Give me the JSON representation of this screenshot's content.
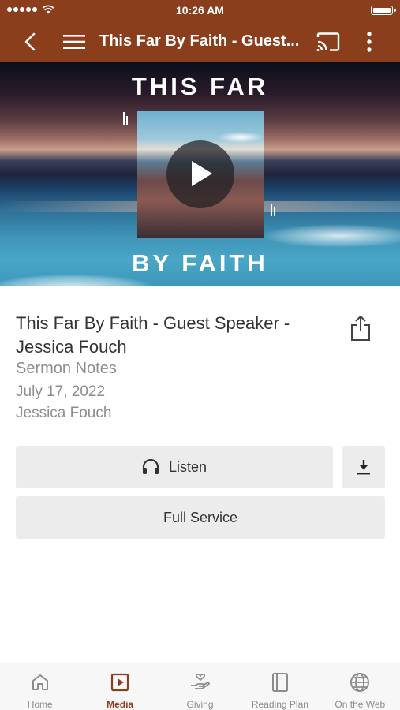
{
  "status_bar": {
    "time": "10:26 AM"
  },
  "nav": {
    "title": "This Far By Faith - Guest..."
  },
  "hero": {
    "title_top": "THIS FAR",
    "title_bottom": "BY FAITH"
  },
  "sermon": {
    "title": "This Far By Faith - Guest Speaker - Jessica Fouch",
    "series": "Sermon Notes",
    "date": "July 17, 2022",
    "speaker": "Jessica Fouch"
  },
  "actions": {
    "listen_label": "Listen",
    "full_service_label": "Full Service"
  },
  "tabs": [
    {
      "label": "Home",
      "icon": "home-icon"
    },
    {
      "label": "Media",
      "icon": "media-icon",
      "active": true
    },
    {
      "label": "Giving",
      "icon": "giving-icon"
    },
    {
      "label": "Reading Plan",
      "icon": "reading-plan-icon"
    },
    {
      "label": "On the Web",
      "icon": "globe-icon"
    }
  ],
  "colors": {
    "brand": "#8a3e1c",
    "button_bg": "#ececec",
    "meta_text": "#8e8e8e",
    "tab_inactive": "#8c8c8c"
  }
}
